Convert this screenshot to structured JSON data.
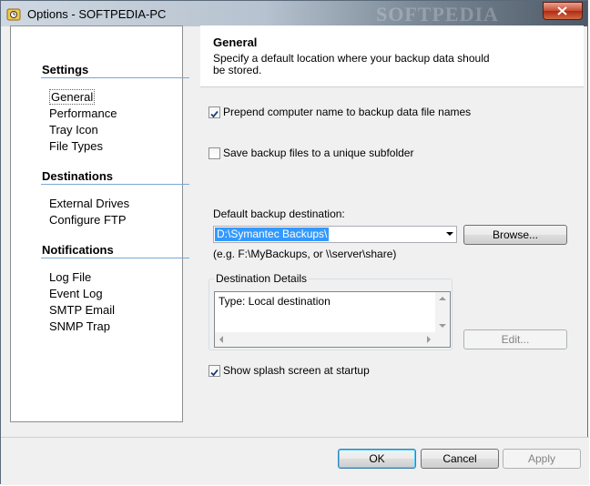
{
  "window": {
    "title": "Options - SOFTPEDIA-PC",
    "watermark": "SOFTPEDIA"
  },
  "sidebar": {
    "sections": [
      {
        "heading": "Settings",
        "items": [
          "General",
          "Performance",
          "Tray Icon",
          "File Types"
        ]
      },
      {
        "heading": "Destinations",
        "items": [
          "External Drives",
          "Configure FTP"
        ]
      },
      {
        "heading": "Notifications",
        "items": [
          "Log File",
          "Event Log",
          "SMTP Email",
          "SNMP Trap"
        ]
      }
    ],
    "selected": "General"
  },
  "panel": {
    "title": "General",
    "description": "Specify a default location where your backup data should be stored.",
    "prepend_checkbox": {
      "label": "Prepend computer name to backup data file names",
      "checked": true
    },
    "subfolder_checkbox": {
      "label": "Save backup files to a unique subfolder",
      "checked": false
    },
    "destination_label": "Default backup destination:",
    "destination_value": "D:\\Symantec Backups\\",
    "browse_label": "Browse...",
    "example_text": "(e.g. F:\\MyBackups, or \\\\server\\share)",
    "details_group_label": "Destination Details",
    "details_text": "Type: Local destination",
    "edit_label": "Edit...",
    "splash_checkbox": {
      "label": "Show splash screen at startup",
      "checked": true
    }
  },
  "footer": {
    "ok_label": "OK",
    "cancel_label": "Cancel",
    "apply_label": "Apply"
  },
  "colors": {
    "accent_line": "#7aa7d8",
    "selection": "#3399ff"
  }
}
